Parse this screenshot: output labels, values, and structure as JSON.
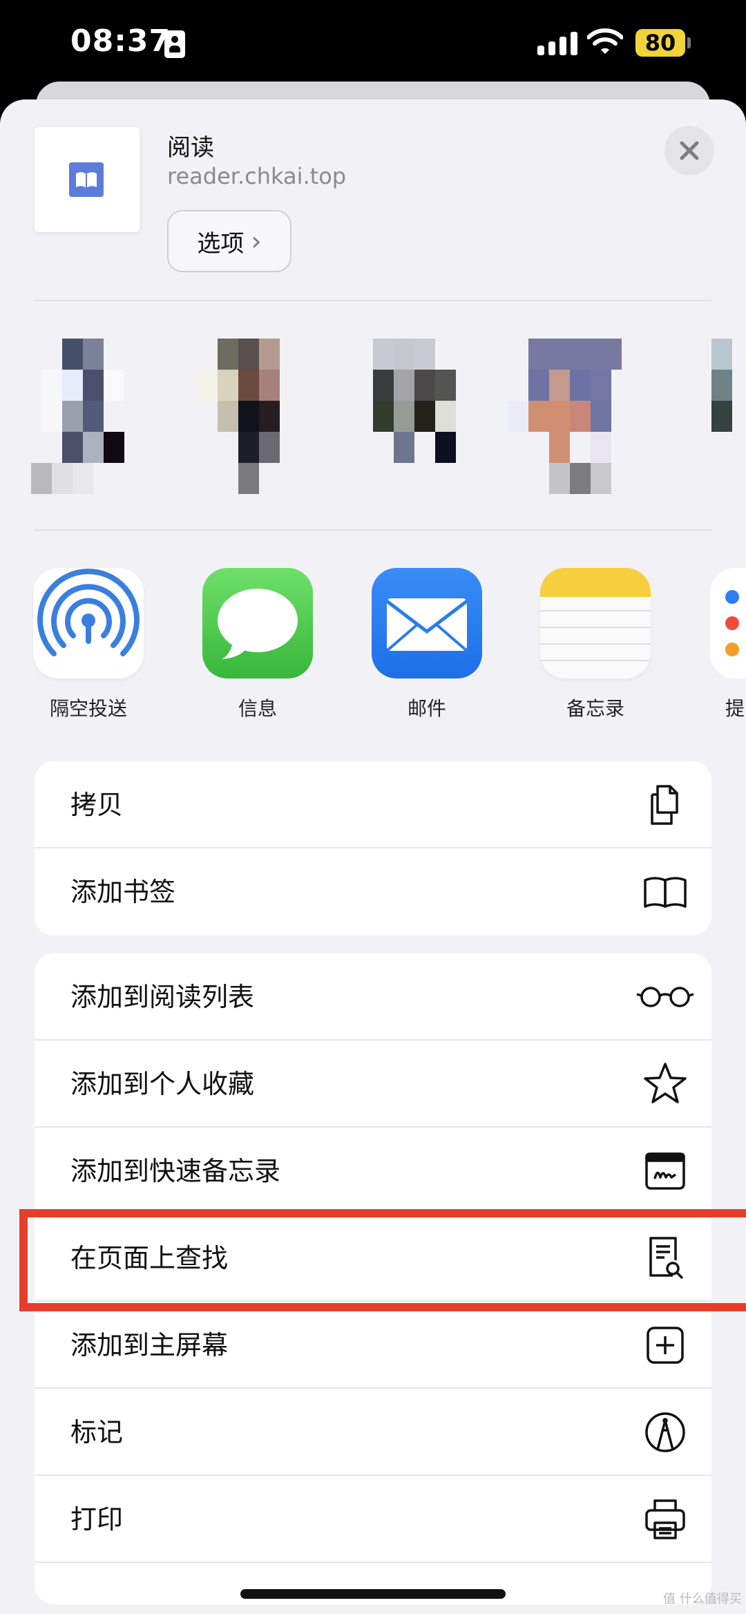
{
  "status_bar": {
    "time": "08:37",
    "battery": "80",
    "icons": [
      "id-card-icon",
      "cellular-signal-icon",
      "wifi-icon",
      "battery-icon"
    ]
  },
  "share_header": {
    "title": "阅读",
    "url": "reader.chkai.top",
    "options_label": "选项",
    "options_chevron": "›",
    "close_glyph": "✕"
  },
  "apps": [
    {
      "label": "隔空投送",
      "icon": "airdrop-icon"
    },
    {
      "label": "信息",
      "icon": "messages-icon"
    },
    {
      "label": "邮件",
      "icon": "mail-icon"
    },
    {
      "label": "备忘录",
      "icon": "notes-icon"
    },
    {
      "label": "提",
      "icon": "reminders-icon"
    }
  ],
  "actions_group1": [
    {
      "label": "拷贝",
      "icon": "copy-icon"
    },
    {
      "label": "添加书签",
      "icon": "book-icon"
    }
  ],
  "actions_group2": [
    {
      "label": "添加到阅读列表",
      "icon": "glasses-icon"
    },
    {
      "label": "添加到个人收藏",
      "icon": "star-icon"
    },
    {
      "label": "添加到快速备忘录",
      "icon": "quick-note-icon"
    },
    {
      "label": "在页面上查找",
      "icon": "find-on-page-icon"
    },
    {
      "label": "添加到主屏幕",
      "icon": "add-square-icon"
    },
    {
      "label": "标记",
      "icon": "markup-icon"
    },
    {
      "label": "打印",
      "icon": "printer-icon"
    }
  ],
  "colors": {
    "highlight": "#e53f2b",
    "battery": "#f0d43a",
    "sheet": "#f2f2f6"
  },
  "watermark": "值 什么值得买"
}
